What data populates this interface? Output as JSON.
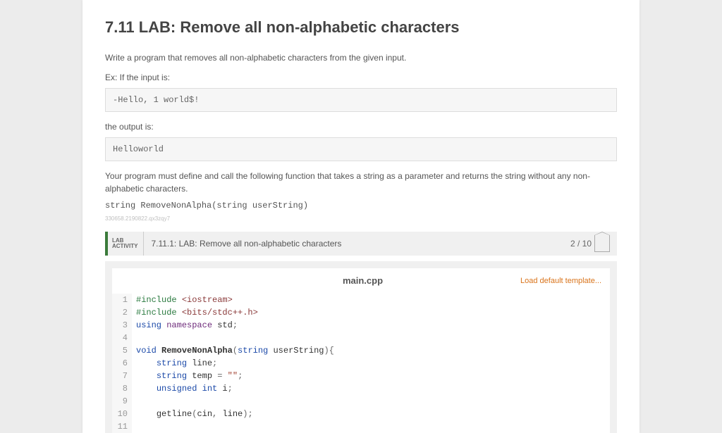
{
  "title": "7.11 LAB: Remove all non-alphabetic characters",
  "intro": "Write a program that removes all non-alphabetic characters from the given input.",
  "ex_label_1": "Ex: If the input is:",
  "example_input": "-Hello, 1 world$!",
  "ex_label_2": "the output is:",
  "example_output": "Helloworld",
  "requirement": "Your program must define and call the following function that takes a string as a parameter and returns the string without any non-alphabetic characters.",
  "signature": "string RemoveNonAlpha(string userString)",
  "meta": "330658.2190822.qx3zqy7",
  "lab": {
    "badge_l1": "LAB",
    "badge_l2": "ACTIVITY",
    "title": "7.11.1: LAB: Remove all non-alphabetic characters",
    "score": "2 / 10"
  },
  "editor": {
    "filename": "main.cpp",
    "load_template": "Load default template...",
    "lines": [
      {
        "n": 1,
        "tokens": [
          [
            "pre",
            "#include "
          ],
          [
            "inc",
            "<iostream>"
          ]
        ]
      },
      {
        "n": 2,
        "tokens": [
          [
            "pre",
            "#include "
          ],
          [
            "inc",
            "<bits/stdc++.h>"
          ]
        ]
      },
      {
        "n": 3,
        "tokens": [
          [
            "kw",
            "using "
          ],
          [
            "ns",
            "namespace "
          ],
          [
            "id",
            "std"
          ],
          [
            "punc",
            ";"
          ]
        ]
      },
      {
        "n": 4,
        "tokens": []
      },
      {
        "n": 5,
        "tokens": [
          [
            "kw",
            "void "
          ],
          [
            "fn",
            "RemoveNonAlpha"
          ],
          [
            "punc",
            "("
          ],
          [
            "kw",
            "string"
          ],
          [
            "id",
            " userString"
          ],
          [
            "punc",
            "){"
          ]
        ]
      },
      {
        "n": 6,
        "tokens": [
          [
            "id",
            "    "
          ],
          [
            "kw",
            "string"
          ],
          [
            "id",
            " line"
          ],
          [
            "punc",
            ";"
          ]
        ]
      },
      {
        "n": 7,
        "tokens": [
          [
            "id",
            "    "
          ],
          [
            "kw",
            "string"
          ],
          [
            "id",
            " temp "
          ],
          [
            "punc",
            "= "
          ],
          [
            "str",
            "\"\""
          ],
          [
            "punc",
            ";"
          ]
        ]
      },
      {
        "n": 8,
        "tokens": [
          [
            "id",
            "    "
          ],
          [
            "kw",
            "unsigned int"
          ],
          [
            "id",
            " i"
          ],
          [
            "punc",
            ";"
          ]
        ]
      },
      {
        "n": 9,
        "tokens": []
      },
      {
        "n": 10,
        "tokens": [
          [
            "id",
            "    "
          ],
          [
            "id",
            "getline"
          ],
          [
            "punc",
            "("
          ],
          [
            "id",
            "cin"
          ],
          [
            "punc",
            ", "
          ],
          [
            "id",
            "line"
          ],
          [
            "punc",
            ");"
          ]
        ]
      },
      {
        "n": 11,
        "tokens": []
      }
    ]
  }
}
